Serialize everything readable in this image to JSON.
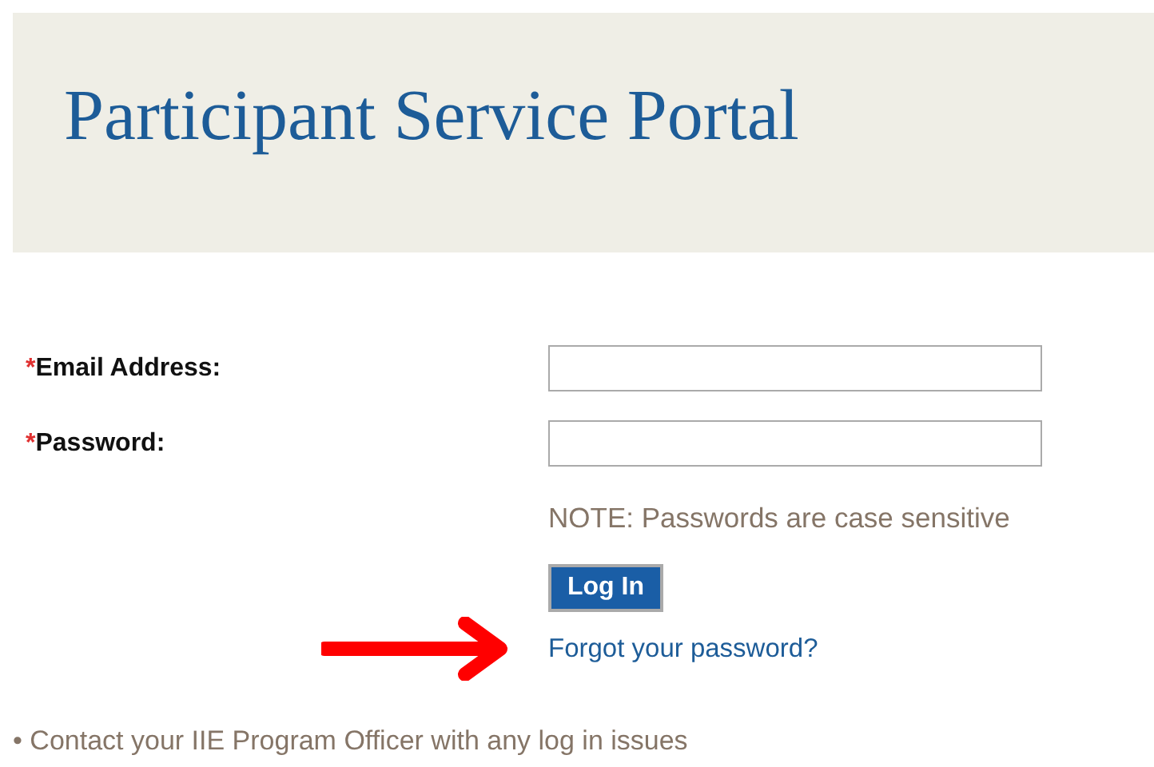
{
  "header": {
    "title": "Participant Service Portal"
  },
  "fields": [
    {
      "required_mark": "*",
      "label": "Email Address:"
    },
    {
      "required_mark": "*",
      "label": "Password:"
    }
  ],
  "note": "NOTE: Passwords are case sensitive",
  "login_button": "Log In",
  "forgot_link": "Forgot your password?",
  "help": "• Contact your IIE Program Officer with any log in issues"
}
